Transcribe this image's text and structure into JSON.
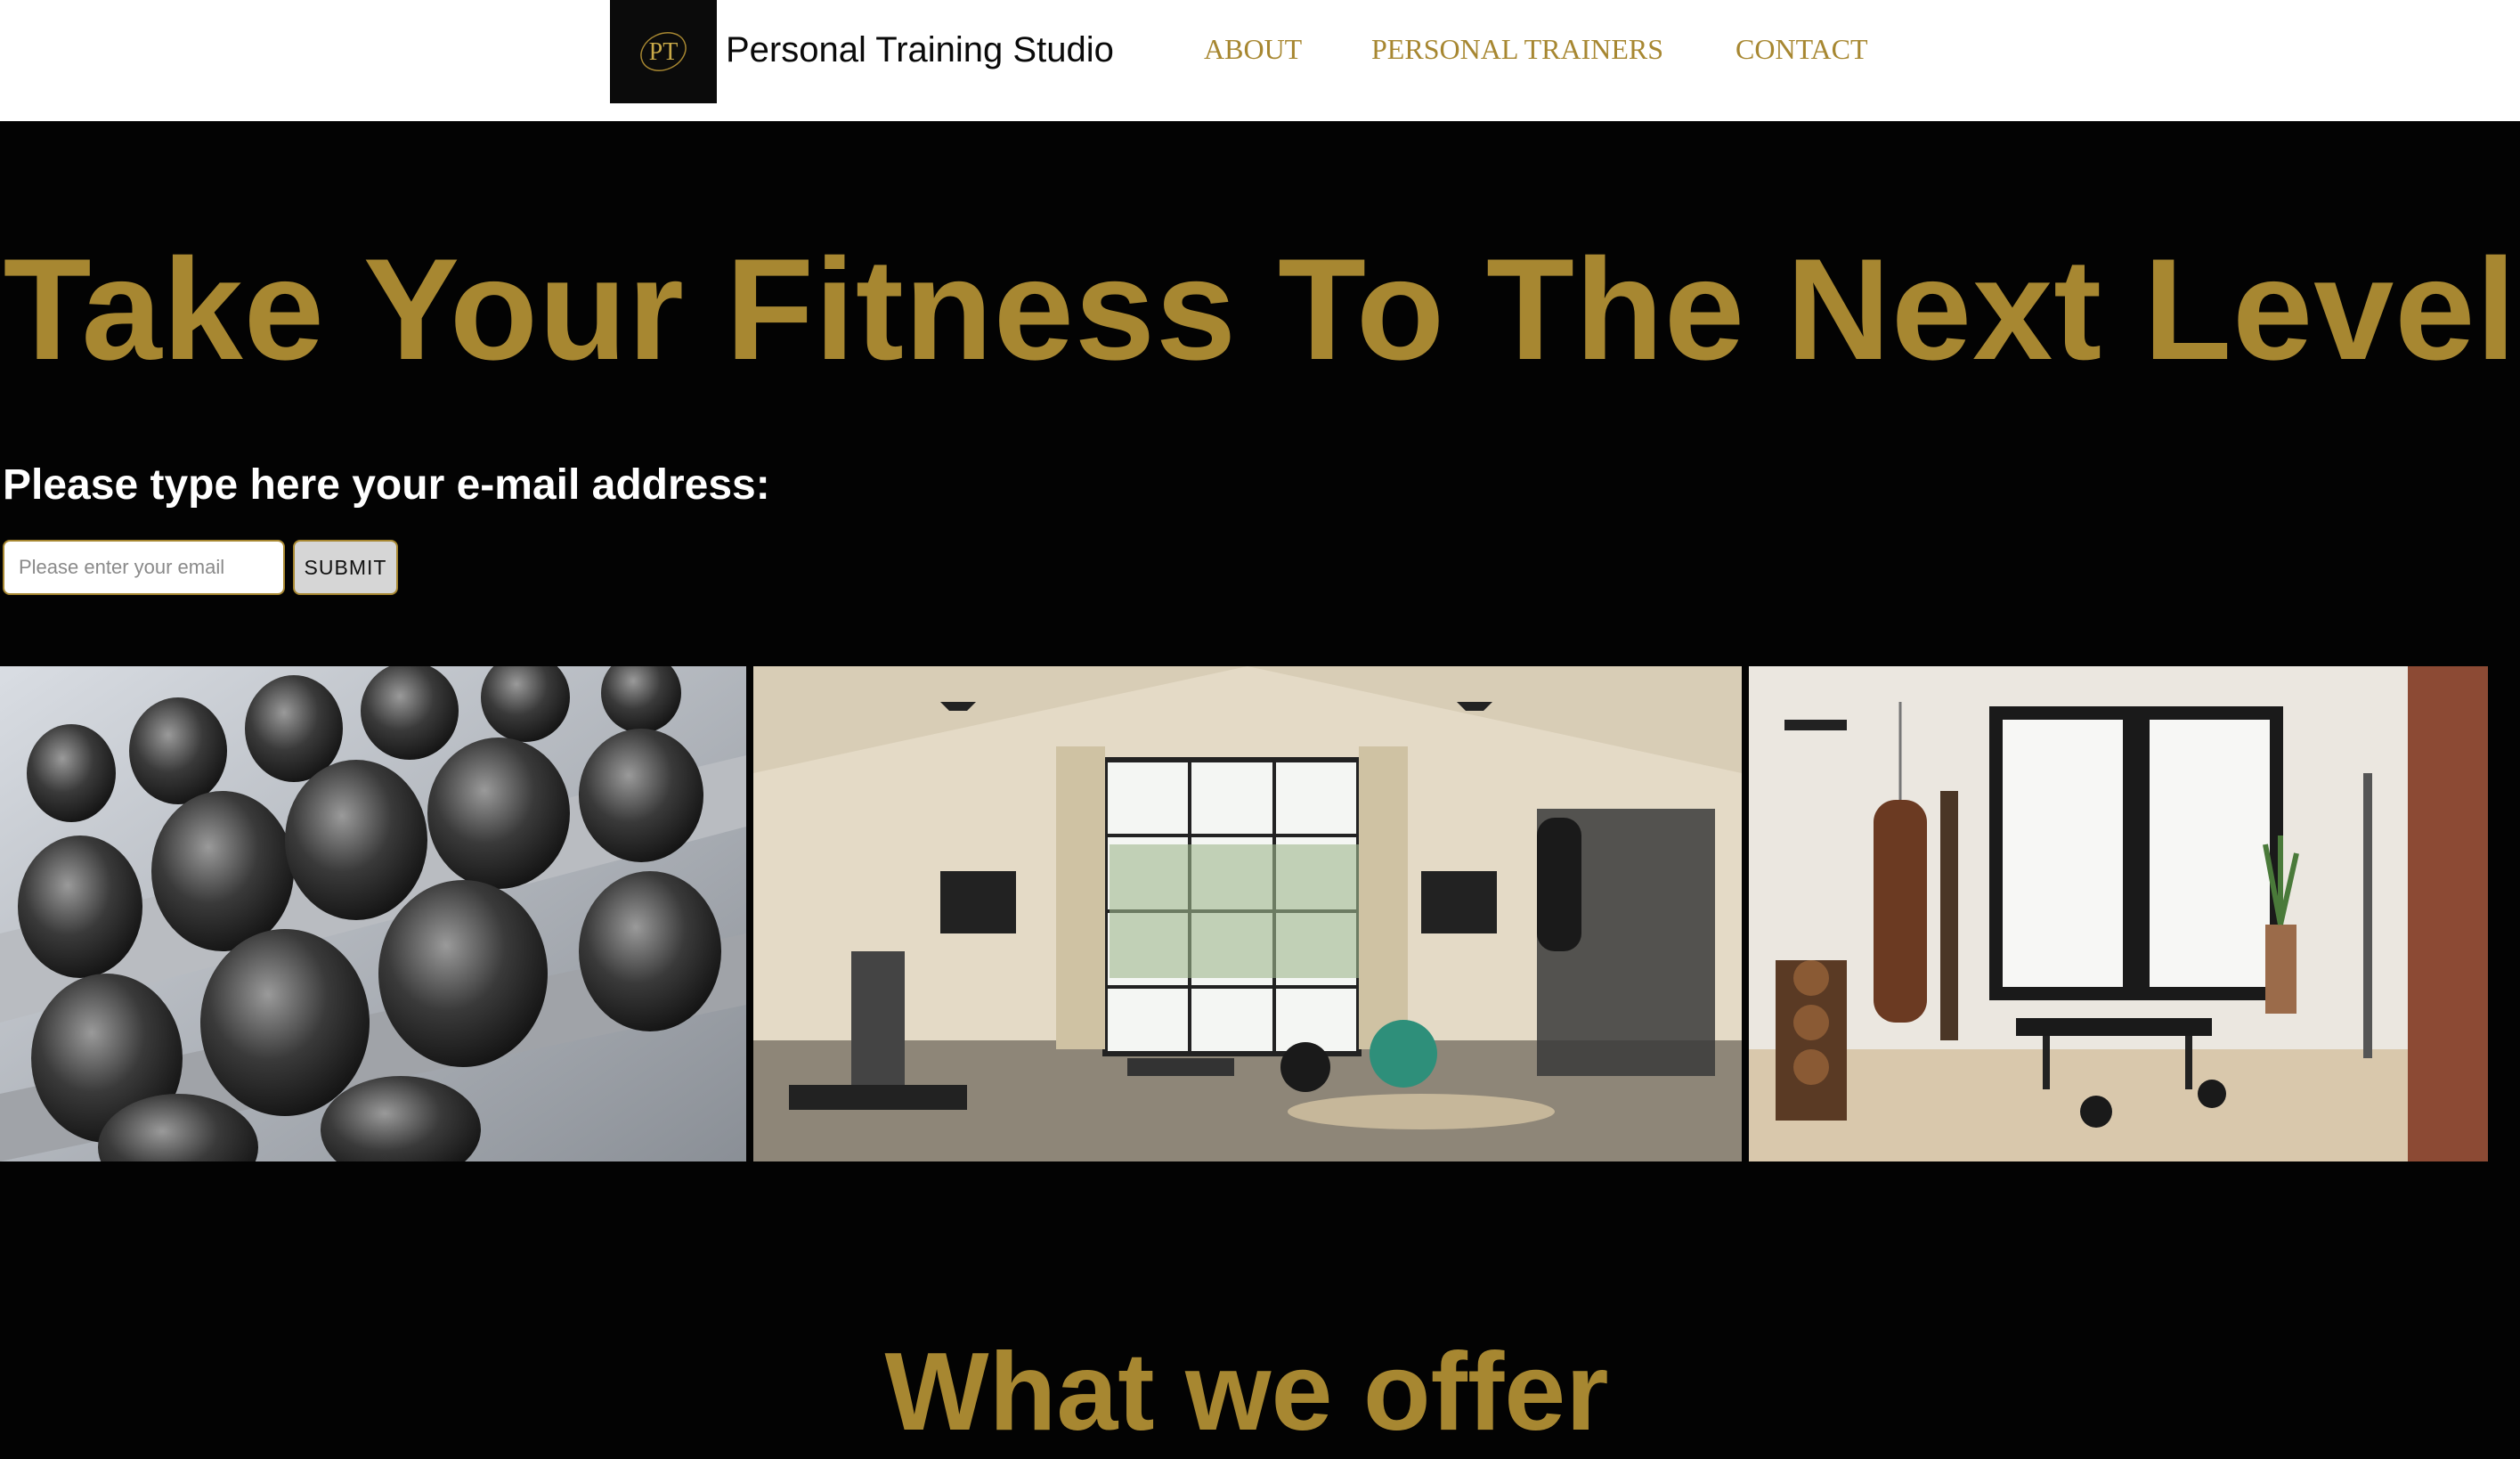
{
  "header": {
    "logo_monogram": "PT",
    "brand": "Personal Training Studio",
    "nav": [
      {
        "label": "ABOUT"
      },
      {
        "label": "PERSONAL TRAINERS"
      },
      {
        "label": "CONTACT"
      }
    ]
  },
  "hero": {
    "title": "Take Your Fitness To The Next Level",
    "email_label": "Please type here your e-mail address:",
    "email_placeholder": "Please enter your email",
    "email_value": "",
    "submit_label": "SUBMIT"
  },
  "gallery": [
    {
      "name": "dumbbell-rack-photo"
    },
    {
      "name": "home-gym-room-photo"
    },
    {
      "name": "boxing-room-photo"
    }
  ],
  "offer": {
    "title": "What we offer"
  },
  "colors": {
    "accent_gold": "#a78731",
    "background": "#030303",
    "header_bg": "#ffffff"
  }
}
